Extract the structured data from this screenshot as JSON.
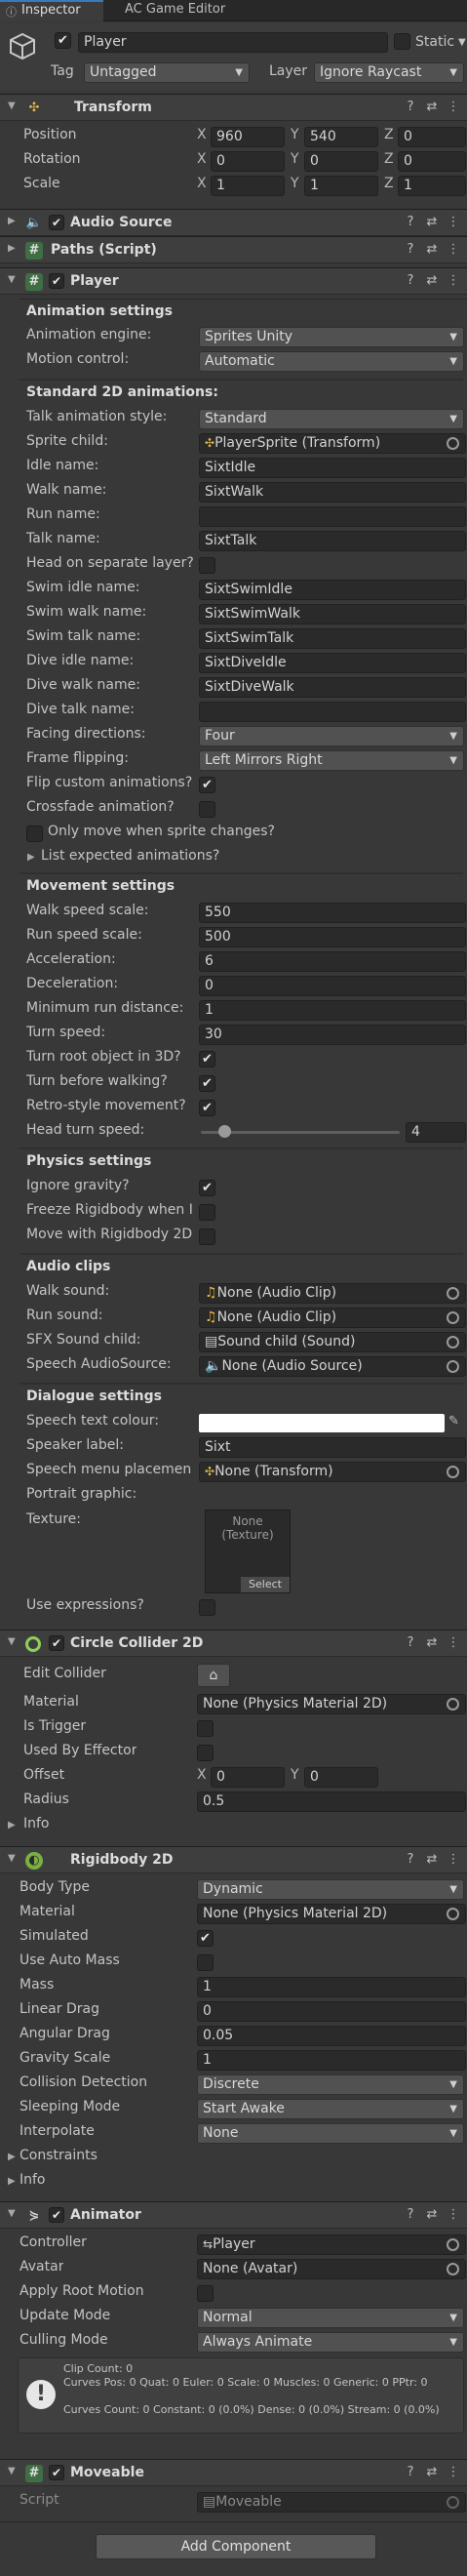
{
  "tabs": {
    "inspector": "Inspector",
    "ac_editor": "AC Game Editor"
  },
  "object": {
    "name": "Player",
    "static_label": "Static",
    "tag_label": "Tag",
    "tag_value": "Untagged",
    "layer_label": "Layer",
    "layer_value": "Ignore Raycast"
  },
  "transform": {
    "title": "Transform",
    "position_label": "Position",
    "rotation_label": "Rotation",
    "scale_label": "Scale",
    "position": [
      "960",
      "540",
      "0"
    ],
    "rotation": [
      "0",
      "0",
      "0"
    ],
    "scale": [
      "1",
      "1",
      "1"
    ],
    "axes": [
      "X",
      "Y",
      "Z"
    ]
  },
  "audio_source": {
    "title": "Audio Source"
  },
  "paths": {
    "title": "Paths (Script)"
  },
  "player": {
    "title": "Player",
    "anim_settings": {
      "header": "Animation settings",
      "engine_label": "Animation engine:",
      "engine_value": "Sprites Unity",
      "motion_label": "Motion control:",
      "motion_value": "Automatic"
    },
    "std2d": {
      "header": "Standard 2D animations:",
      "style_label": "Talk animation style:",
      "style_value": "Standard",
      "sprite_child_label": "Sprite child:",
      "sprite_child_value": "PlayerSprite (Transform)",
      "idle_label": "Idle name:",
      "idle_value": "SixtIdle",
      "walk_label": "Walk name:",
      "walk_value": "SixtWalk",
      "run_label": "Run name:",
      "run_value": "",
      "talk_label": "Talk name:",
      "talk_value": "SixtTalk",
      "sep_layer_label": "Head on separate layer?",
      "swim_idle_label": "Swim idle name:",
      "swim_idle_value": "SixtSwimIdle",
      "swim_walk_label": "Swim walk name:",
      "swim_walk_value": "SixtSwimWalk",
      "swim_talk_label": "Swim talk name:",
      "swim_talk_value": "SixtSwimTalk",
      "dive_idle_label": "Dive idle name:",
      "dive_idle_value": "SixtDiveIdle",
      "dive_walk_label": "Dive walk name:",
      "dive_walk_value": "SixtDiveWalk",
      "dive_talk_label": "Dive talk name:",
      "dive_talk_value": "",
      "facing_label": "Facing directions:",
      "facing_value": "Four",
      "flip_label": "Frame flipping:",
      "flip_value": "Left Mirrors Right",
      "flip_custom_label": "Flip custom animations?",
      "crossfade_label": "Crossfade animation?",
      "only_move_label": "Only move when sprite changes?",
      "list_expected_label": "List expected animations?"
    },
    "movement": {
      "header": "Movement settings",
      "walk_speed_label": "Walk speed scale:",
      "walk_speed_value": "550",
      "run_speed_label": "Run speed scale:",
      "run_speed_value": "500",
      "accel_label": "Acceleration:",
      "accel_value": "6",
      "decel_label": "Deceleration:",
      "decel_value": "0",
      "min_run_label": "Minimum run distance:",
      "min_run_value": "1",
      "turn_speed_label": "Turn speed:",
      "turn_speed_value": "30",
      "turn_root_label": "Turn root object in 3D?",
      "turn_before_label": "Turn before walking?",
      "retro_label": "Retro-style movement?",
      "head_turn_label": "Head turn speed:",
      "head_turn_value": "4",
      "head_turn_fraction": 0.12
    },
    "physics": {
      "header": "Physics settings",
      "ignore_gravity_label": "Ignore gravity?",
      "freeze_label": "Freeze Rigidbody when I",
      "move_rb_label": "Move with Rigidbody 2D"
    },
    "audio": {
      "header": "Audio clips",
      "walk_sound_label": "Walk sound:",
      "walk_sound_value": "None (Audio Clip)",
      "run_sound_label": "Run sound:",
      "run_sound_value": "None (Audio Clip)",
      "sfx_label": "SFX Sound child:",
      "sfx_value": "Sound child (Sound)",
      "speech_label": "Speech AudioSource:",
      "speech_value": "None (Audio Source)"
    },
    "dialogue": {
      "header": "Dialogue settings",
      "colour_label": "Speech text colour:",
      "colour_value": "#ffffff",
      "speaker_label": "Speaker label:",
      "speaker_value": "Sixt",
      "menu_label": "Speech menu placemen",
      "menu_value": "None (Transform)",
      "portrait_label": "Portrait graphic:",
      "texture_label": "Texture:",
      "texture_none": "None",
      "texture_type": "(Texture)",
      "texture_select": "Select",
      "expressions_label": "Use expressions?"
    }
  },
  "circle_collider": {
    "title": "Circle Collider 2D",
    "edit_label": "Edit Collider",
    "material_label": "Material",
    "material_value": "None (Physics Material 2D)",
    "trigger_label": "Is Trigger",
    "effector_label": "Used By Effector",
    "offset_label": "Offset",
    "offset_x": "0",
    "offset_y": "0",
    "radius_label": "Radius",
    "radius_value": "0.5",
    "info_label": "Info"
  },
  "rigidbody": {
    "title": "Rigidbody 2D",
    "body_type_label": "Body Type",
    "body_type_value": "Dynamic",
    "material_label": "Material",
    "material_value": "None (Physics Material 2D)",
    "simulated_label": "Simulated",
    "auto_mass_label": "Use Auto Mass",
    "mass_label": "Mass",
    "mass_value": "1",
    "linear_drag_label": "Linear Drag",
    "linear_drag_value": "0",
    "angular_drag_label": "Angular Drag",
    "angular_drag_value": "0.05",
    "gravity_label": "Gravity Scale",
    "gravity_value": "1",
    "collision_label": "Collision Detection",
    "collision_value": "Discrete",
    "sleeping_label": "Sleeping Mode",
    "sleeping_value": "Start Awake",
    "interpolate_label": "Interpolate",
    "interpolate_value": "None",
    "constraints_label": "Constraints",
    "info_label": "Info"
  },
  "animator": {
    "title": "Animator",
    "controller_label": "Controller",
    "controller_value": "Player",
    "avatar_label": "Avatar",
    "avatar_value": "None (Avatar)",
    "root_motion_label": "Apply Root Motion",
    "update_label": "Update Mode",
    "update_value": "Normal",
    "culling_label": "Culling Mode",
    "culling_value": "Always Animate",
    "info_line1": "Clip Count: 0",
    "info_line2": "Curves Pos: 0 Quat: 0 Euler: 0 Scale: 0 Muscles: 0 Generic: 0 PPtr: 0",
    "info_line3": "Curves Count: 0 Constant: 0 (0.0%) Dense: 0 (0.0%) Stream: 0 (0.0%)"
  },
  "moveable": {
    "title": "Moveable",
    "script_label": "Script",
    "script_value": "Moveable"
  },
  "add_component": "Add Component"
}
